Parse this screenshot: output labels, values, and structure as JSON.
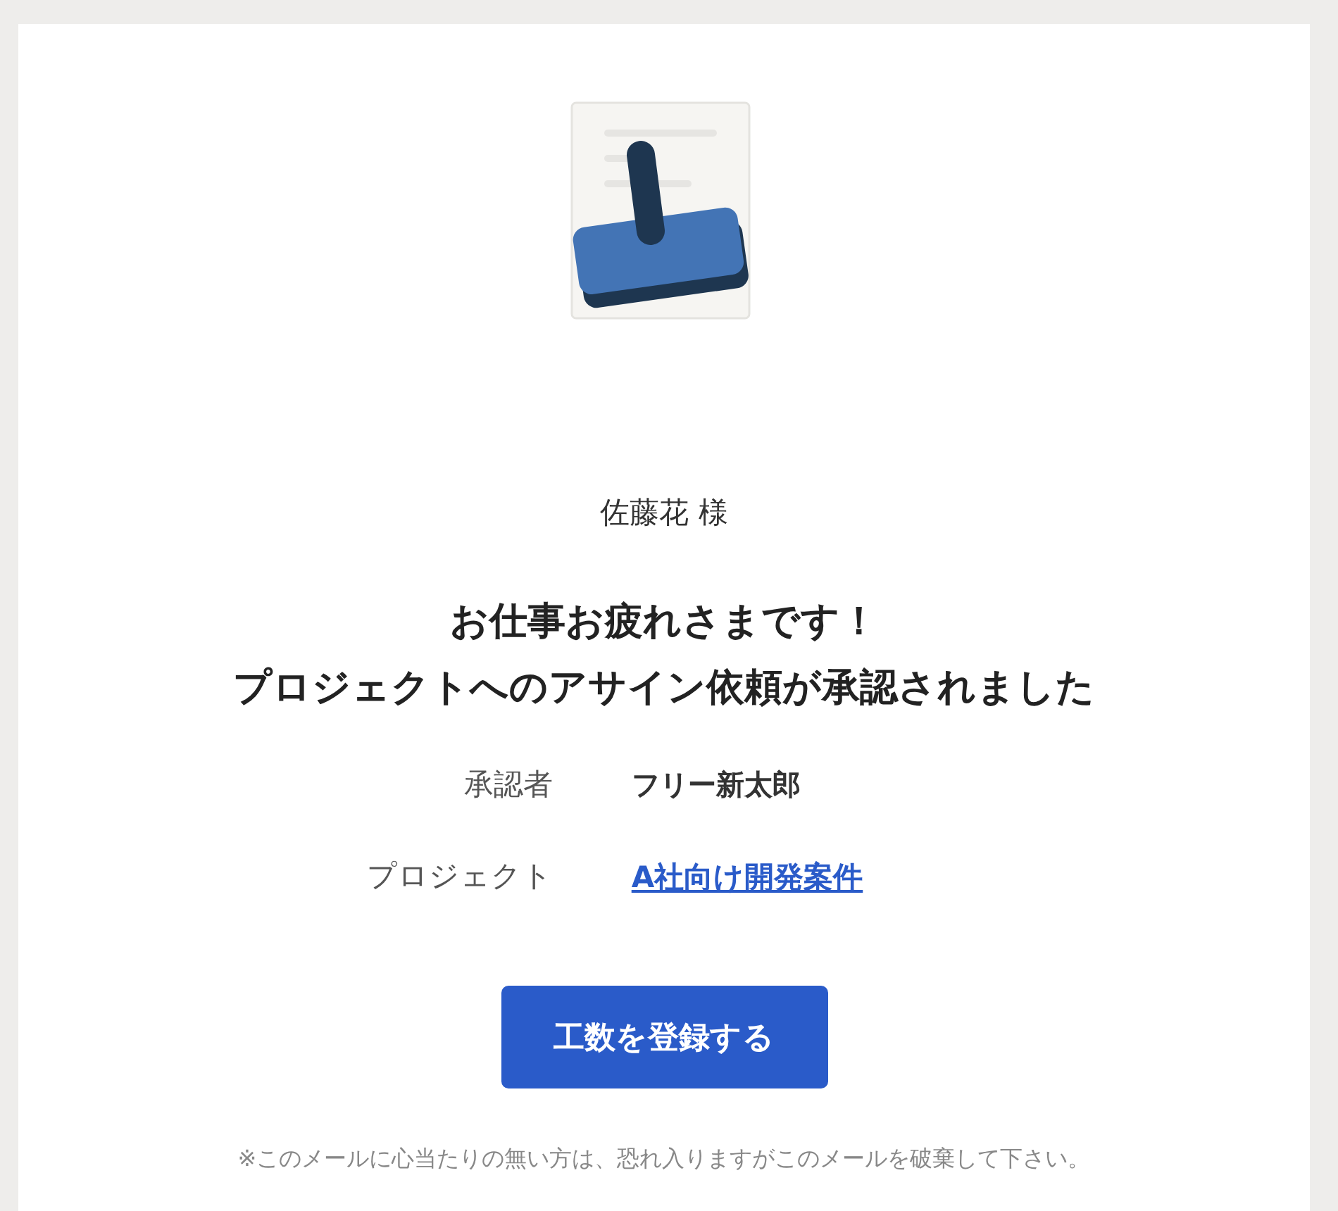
{
  "recipient": "佐藤花 様",
  "heading": [
    "お仕事お疲れさまです！",
    "プロジェクトへのアサイン依頼が承認されました"
  ],
  "details": [
    {
      "label": "承認者",
      "value": "フリー新太郎",
      "kind": "text"
    },
    {
      "label": "プロジェクト",
      "value": "A社向け開発案件",
      "kind": "link"
    }
  ],
  "button": "工数を登録する",
  "note": "※このメールに心当たりの無い方は、恐れ入りますがこのメールを破棄して下さい。"
}
